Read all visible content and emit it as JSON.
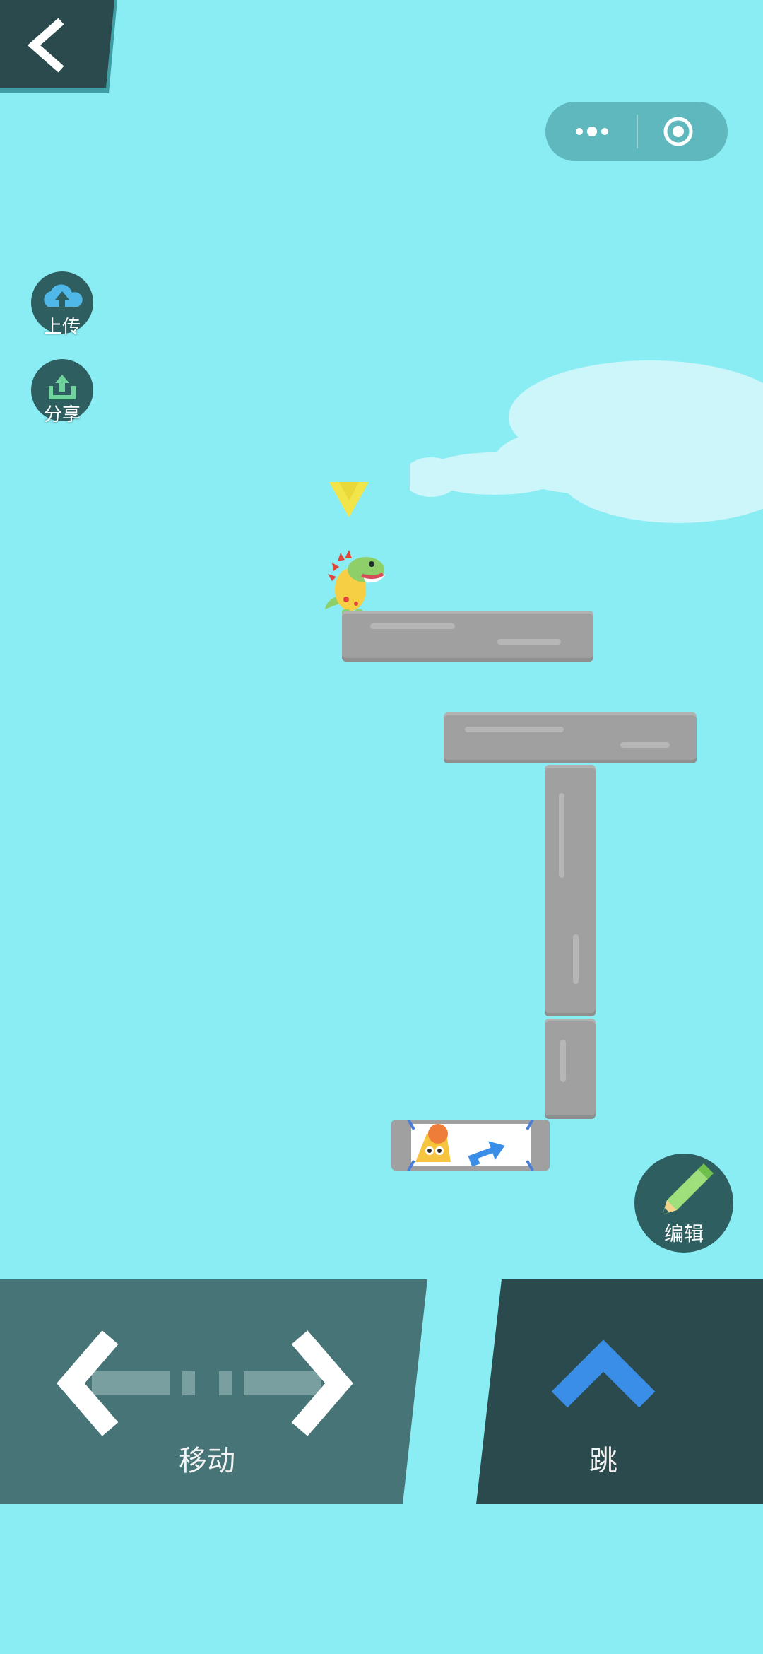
{
  "sidebar": {
    "upload_label": "上传",
    "share_label": "分享"
  },
  "editor": {
    "edit_label": "编辑"
  },
  "controls": {
    "move_label": "移动",
    "jump_label": "跳"
  },
  "icons": {
    "back": "chevron-left-icon",
    "more": "more-dots-icon",
    "close": "target-circle-icon",
    "upload": "cloud-upload-icon",
    "share": "share-upload-icon",
    "edit": "pencil-icon",
    "move": "left-right-arrows-icon",
    "jump": "chevron-up-icon"
  },
  "colors": {
    "sky": "#8aedf3",
    "stone": "#a0a0a0",
    "panel_dark": "#2a4a4d",
    "panel_mid": "#467477",
    "jump_arrow": "#3b8ee8",
    "pointer": "#f2e54a"
  }
}
